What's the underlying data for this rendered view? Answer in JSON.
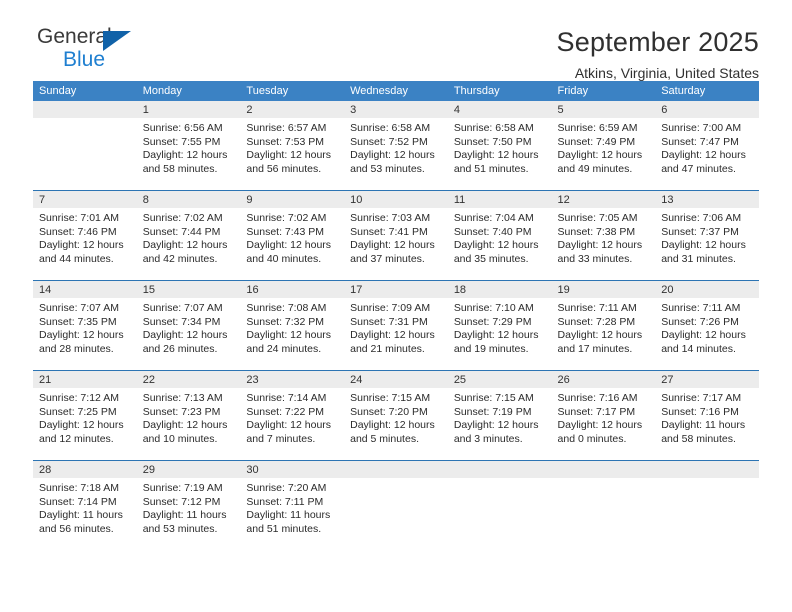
{
  "brand": {
    "name_top": "General",
    "name_bottom": "Blue",
    "color_top": "#3a3a3a",
    "color_bottom": "#1f7fd0",
    "triangle_color": "#1162a8"
  },
  "header": {
    "title": "September 2025",
    "subtitle": "Atkins, Virginia, United States"
  },
  "theme": {
    "header_row_bg": "#3b82c4",
    "header_row_text": "#ffffff",
    "week_border": "#2c74b3",
    "daynum_band_bg": "#ececec",
    "cell_bg": "#ffffff"
  },
  "weekday_headers": [
    "Sunday",
    "Monday",
    "Tuesday",
    "Wednesday",
    "Thursday",
    "Friday",
    "Saturday"
  ],
  "weeks": [
    [
      {
        "day": "",
        "sunrise": "",
        "sunset": "",
        "daylight_line1": "",
        "daylight_line2": ""
      },
      {
        "day": "1",
        "sunrise": "Sunrise: 6:56 AM",
        "sunset": "Sunset: 7:55 PM",
        "daylight_line1": "Daylight: 12 hours",
        "daylight_line2": "and 58 minutes."
      },
      {
        "day": "2",
        "sunrise": "Sunrise: 6:57 AM",
        "sunset": "Sunset: 7:53 PM",
        "daylight_line1": "Daylight: 12 hours",
        "daylight_line2": "and 56 minutes."
      },
      {
        "day": "3",
        "sunrise": "Sunrise: 6:58 AM",
        "sunset": "Sunset: 7:52 PM",
        "daylight_line1": "Daylight: 12 hours",
        "daylight_line2": "and 53 minutes."
      },
      {
        "day": "4",
        "sunrise": "Sunrise: 6:58 AM",
        "sunset": "Sunset: 7:50 PM",
        "daylight_line1": "Daylight: 12 hours",
        "daylight_line2": "and 51 minutes."
      },
      {
        "day": "5",
        "sunrise": "Sunrise: 6:59 AM",
        "sunset": "Sunset: 7:49 PM",
        "daylight_line1": "Daylight: 12 hours",
        "daylight_line2": "and 49 minutes."
      },
      {
        "day": "6",
        "sunrise": "Sunrise: 7:00 AM",
        "sunset": "Sunset: 7:47 PM",
        "daylight_line1": "Daylight: 12 hours",
        "daylight_line2": "and 47 minutes."
      }
    ],
    [
      {
        "day": "7",
        "sunrise": "Sunrise: 7:01 AM",
        "sunset": "Sunset: 7:46 PM",
        "daylight_line1": "Daylight: 12 hours",
        "daylight_line2": "and 44 minutes."
      },
      {
        "day": "8",
        "sunrise": "Sunrise: 7:02 AM",
        "sunset": "Sunset: 7:44 PM",
        "daylight_line1": "Daylight: 12 hours",
        "daylight_line2": "and 42 minutes."
      },
      {
        "day": "9",
        "sunrise": "Sunrise: 7:02 AM",
        "sunset": "Sunset: 7:43 PM",
        "daylight_line1": "Daylight: 12 hours",
        "daylight_line2": "and 40 minutes."
      },
      {
        "day": "10",
        "sunrise": "Sunrise: 7:03 AM",
        "sunset": "Sunset: 7:41 PM",
        "daylight_line1": "Daylight: 12 hours",
        "daylight_line2": "and 37 minutes."
      },
      {
        "day": "11",
        "sunrise": "Sunrise: 7:04 AM",
        "sunset": "Sunset: 7:40 PM",
        "daylight_line1": "Daylight: 12 hours",
        "daylight_line2": "and 35 minutes."
      },
      {
        "day": "12",
        "sunrise": "Sunrise: 7:05 AM",
        "sunset": "Sunset: 7:38 PM",
        "daylight_line1": "Daylight: 12 hours",
        "daylight_line2": "and 33 minutes."
      },
      {
        "day": "13",
        "sunrise": "Sunrise: 7:06 AM",
        "sunset": "Sunset: 7:37 PM",
        "daylight_line1": "Daylight: 12 hours",
        "daylight_line2": "and 31 minutes."
      }
    ],
    [
      {
        "day": "14",
        "sunrise": "Sunrise: 7:07 AM",
        "sunset": "Sunset: 7:35 PM",
        "daylight_line1": "Daylight: 12 hours",
        "daylight_line2": "and 28 minutes."
      },
      {
        "day": "15",
        "sunrise": "Sunrise: 7:07 AM",
        "sunset": "Sunset: 7:34 PM",
        "daylight_line1": "Daylight: 12 hours",
        "daylight_line2": "and 26 minutes."
      },
      {
        "day": "16",
        "sunrise": "Sunrise: 7:08 AM",
        "sunset": "Sunset: 7:32 PM",
        "daylight_line1": "Daylight: 12 hours",
        "daylight_line2": "and 24 minutes."
      },
      {
        "day": "17",
        "sunrise": "Sunrise: 7:09 AM",
        "sunset": "Sunset: 7:31 PM",
        "daylight_line1": "Daylight: 12 hours",
        "daylight_line2": "and 21 minutes."
      },
      {
        "day": "18",
        "sunrise": "Sunrise: 7:10 AM",
        "sunset": "Sunset: 7:29 PM",
        "daylight_line1": "Daylight: 12 hours",
        "daylight_line2": "and 19 minutes."
      },
      {
        "day": "19",
        "sunrise": "Sunrise: 7:11 AM",
        "sunset": "Sunset: 7:28 PM",
        "daylight_line1": "Daylight: 12 hours",
        "daylight_line2": "and 17 minutes."
      },
      {
        "day": "20",
        "sunrise": "Sunrise: 7:11 AM",
        "sunset": "Sunset: 7:26 PM",
        "daylight_line1": "Daylight: 12 hours",
        "daylight_line2": "and 14 minutes."
      }
    ],
    [
      {
        "day": "21",
        "sunrise": "Sunrise: 7:12 AM",
        "sunset": "Sunset: 7:25 PM",
        "daylight_line1": "Daylight: 12 hours",
        "daylight_line2": "and 12 minutes."
      },
      {
        "day": "22",
        "sunrise": "Sunrise: 7:13 AM",
        "sunset": "Sunset: 7:23 PM",
        "daylight_line1": "Daylight: 12 hours",
        "daylight_line2": "and 10 minutes."
      },
      {
        "day": "23",
        "sunrise": "Sunrise: 7:14 AM",
        "sunset": "Sunset: 7:22 PM",
        "daylight_line1": "Daylight: 12 hours",
        "daylight_line2": "and 7 minutes."
      },
      {
        "day": "24",
        "sunrise": "Sunrise: 7:15 AM",
        "sunset": "Sunset: 7:20 PM",
        "daylight_line1": "Daylight: 12 hours",
        "daylight_line2": "and 5 minutes."
      },
      {
        "day": "25",
        "sunrise": "Sunrise: 7:15 AM",
        "sunset": "Sunset: 7:19 PM",
        "daylight_line1": "Daylight: 12 hours",
        "daylight_line2": "and 3 minutes."
      },
      {
        "day": "26",
        "sunrise": "Sunrise: 7:16 AM",
        "sunset": "Sunset: 7:17 PM",
        "daylight_line1": "Daylight: 12 hours",
        "daylight_line2": "and 0 minutes."
      },
      {
        "day": "27",
        "sunrise": "Sunrise: 7:17 AM",
        "sunset": "Sunset: 7:16 PM",
        "daylight_line1": "Daylight: 11 hours",
        "daylight_line2": "and 58 minutes."
      }
    ],
    [
      {
        "day": "28",
        "sunrise": "Sunrise: 7:18 AM",
        "sunset": "Sunset: 7:14 PM",
        "daylight_line1": "Daylight: 11 hours",
        "daylight_line2": "and 56 minutes."
      },
      {
        "day": "29",
        "sunrise": "Sunrise: 7:19 AM",
        "sunset": "Sunset: 7:12 PM",
        "daylight_line1": "Daylight: 11 hours",
        "daylight_line2": "and 53 minutes."
      },
      {
        "day": "30",
        "sunrise": "Sunrise: 7:20 AM",
        "sunset": "Sunset: 7:11 PM",
        "daylight_line1": "Daylight: 11 hours",
        "daylight_line2": "and 51 minutes."
      },
      {
        "day": "",
        "sunrise": "",
        "sunset": "",
        "daylight_line1": "",
        "daylight_line2": ""
      },
      {
        "day": "",
        "sunrise": "",
        "sunset": "",
        "daylight_line1": "",
        "daylight_line2": ""
      },
      {
        "day": "",
        "sunrise": "",
        "sunset": "",
        "daylight_line1": "",
        "daylight_line2": ""
      },
      {
        "day": "",
        "sunrise": "",
        "sunset": "",
        "daylight_line1": "",
        "daylight_line2": ""
      }
    ]
  ]
}
